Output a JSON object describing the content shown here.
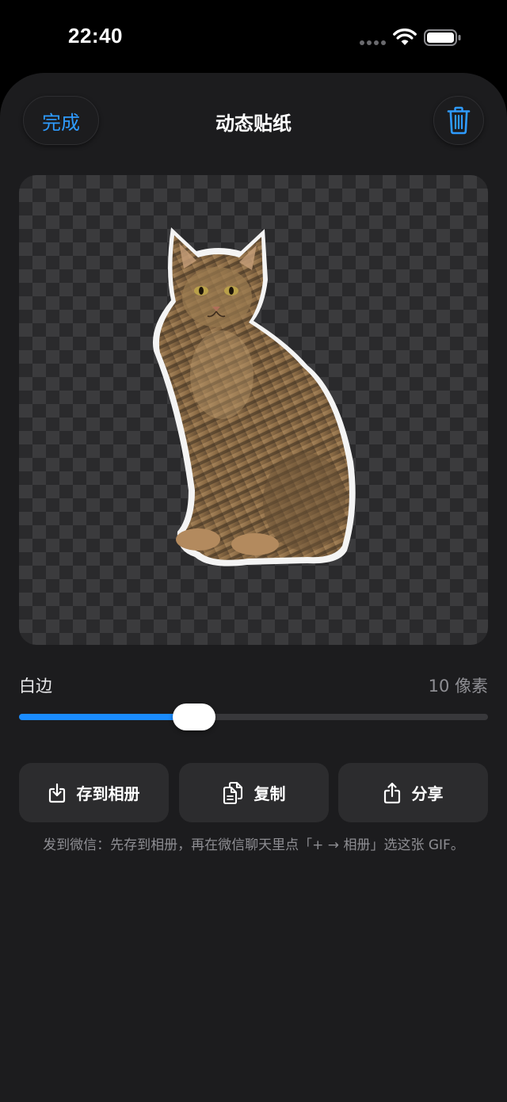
{
  "status_bar": {
    "time": "22:40",
    "icons": [
      "signal-dots-icon",
      "wifi-icon",
      "battery-icon"
    ]
  },
  "header": {
    "done_label": "完成",
    "title": "动态贴纸",
    "trash_icon": "trash-icon"
  },
  "preview": {
    "subject": "cat-sticker",
    "background": "transparency-checkerboard"
  },
  "border_control": {
    "label": "白边",
    "value_text": "10 像素",
    "slider_fraction": 0.36
  },
  "actions": [
    {
      "label": "存到相册",
      "icon": "save-to-album-icon"
    },
    {
      "label": "复制",
      "icon": "copy-icon"
    },
    {
      "label": "分享",
      "icon": "share-icon"
    }
  ],
  "hint": "发到微信：先存到相册，再在微信聊天里点「+ → 相册」选这张 GIF。",
  "colors": {
    "accent": "#1a8cff",
    "background": "#1c1c1e",
    "button": "#2c2c2e"
  }
}
